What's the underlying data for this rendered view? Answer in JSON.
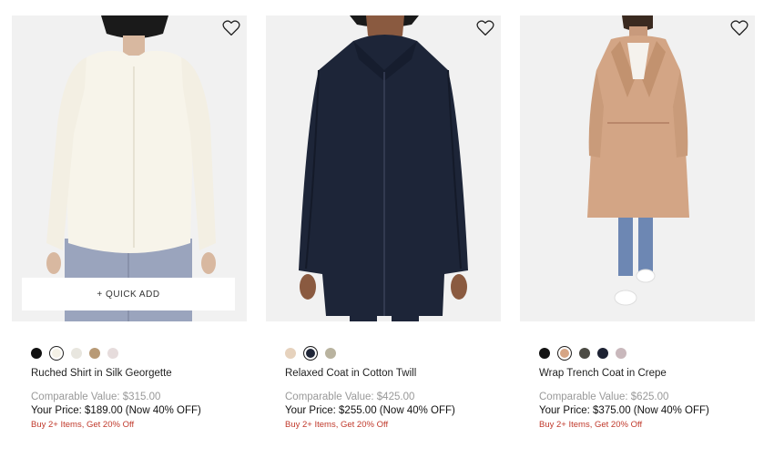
{
  "products": [
    {
      "name": "Ruched Shirt in Silk Georgette",
      "comparable": "Comparable Value: $315.00",
      "your_price": "Your Price: $189.00 (Now 40% OFF)",
      "promo": "Buy 2+ Items, Get 20% Off",
      "quick_add": "+ QUICK ADD",
      "wishlist_icon": "heart-outline-icon",
      "swatches": [
        "#111111",
        "#f4f1e6",
        "#e8e6df",
        "#b89a76",
        "#e6dcdc"
      ],
      "selected_swatch": 1
    },
    {
      "name": "Relaxed Coat in Cotton Twill",
      "comparable": "Comparable Value: $425.00",
      "your_price": "Your Price: $255.00 (Now 40% OFF)",
      "promo": "Buy 2+ Items, Get 20% Off",
      "wishlist_icon": "heart-outline-icon",
      "swatches": [
        "#e6d2bd",
        "#1f2638",
        "#b9b39f"
      ],
      "selected_swatch": 1
    },
    {
      "name": "Wrap Trench Coat in Crepe",
      "comparable": "Comparable Value: $625.00",
      "your_price": "Your Price: $375.00 (Now 40% OFF)",
      "promo": "Buy 2+ Items, Get 20% Off",
      "wishlist_icon": "heart-outline-icon",
      "swatches": [
        "#141414",
        "#d6a585",
        "#4c4b44",
        "#1d2233",
        "#c9b8bc"
      ],
      "selected_swatch": 1
    }
  ],
  "colors": {
    "promo": "#c0392b",
    "comparable": "#999999",
    "image_bg": "#f1f1f1"
  }
}
